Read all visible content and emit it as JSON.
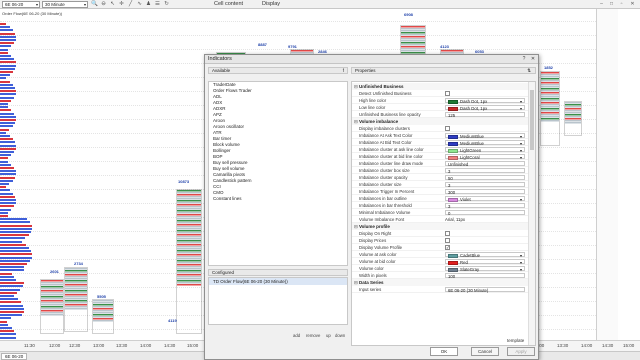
{
  "toolbar": {
    "instrument": "6E 06-20",
    "interval": "30 Minute",
    "cell_content_label": "Cell content",
    "display_label": "Display"
  },
  "chart": {
    "title": "Order Flow(6E 06-20 (30 Minute))",
    "volume_labels": [
      "8887",
      "9791",
      "2846",
      "6908",
      "4123",
      "6053",
      "1852",
      "10873",
      "2601",
      "2734",
      "5505",
      "4119"
    ],
    "time_labels": [
      "11:30",
      "12:00",
      "12:30",
      "13:00",
      "13:30",
      "14:00",
      "14:30",
      "15:00",
      "13:00",
      "13:30",
      "14:00",
      "14:30",
      "15:00"
    ],
    "tab_label": "6E 06-20"
  },
  "dialog": {
    "title": "Indicators",
    "available_label": "Available",
    "configured_label": "Configured",
    "properties_label": "Properties",
    "available_items": [
      "TraderDate",
      "Order Flows Trader",
      "ADL",
      "ADX",
      "ADXR",
      "APZ",
      "Aroon",
      "Aroon oscillator",
      "ATR",
      "Bar timer",
      "Block volume",
      "Bollinger",
      "BOP",
      "Buy sell pressure",
      "Buy sell volume",
      "Camarilla pivots",
      "Candlestick pattern",
      "CCI",
      "CMO",
      "Constant lines"
    ],
    "configured_items": [
      "TD Order Flow(6E 06-20 (30 Minute))"
    ],
    "links": {
      "add": "add",
      "remove": "remove",
      "up": "up",
      "down": "down"
    },
    "sections": [
      {
        "name": "Unfinished Business",
        "rows": [
          {
            "label": "Detect Unfinished Business",
            "type": "check",
            "checked": false
          },
          {
            "label": "High line color",
            "type": "color",
            "value": "Dash Dot, 1px",
            "swatch": "#1e7a34"
          },
          {
            "label": "Low line color",
            "type": "color",
            "value": "Dash Dot, 1px",
            "swatch": "#c62828"
          },
          {
            "label": "Unfinished Business line opacity",
            "type": "text",
            "value": "125"
          }
        ]
      },
      {
        "name": "Volume imbalance",
        "rows": [
          {
            "label": "Display imbalance clusters",
            "type": "check",
            "checked": false
          },
          {
            "label": "Imbalance At Ask Text Color",
            "type": "color",
            "value": "MediumBlue",
            "swatch": "#2e3cc2"
          },
          {
            "label": "Imbalance At Bid Text Color",
            "type": "color",
            "value": "MediumBlue",
            "swatch": "#2e3cc2"
          },
          {
            "label": "Imbalance cluster at ask line color",
            "type": "color",
            "value": "LightGreen",
            "swatch": "#8fe68f"
          },
          {
            "label": "Imbalance cluster at bid line color",
            "type": "color",
            "value": "LightCoral",
            "swatch": "#ef8080"
          },
          {
            "label": "Imbalance cluster line draw mode",
            "type": "text",
            "value": "Unfinished"
          },
          {
            "label": "Imbalance cluster box size",
            "type": "text",
            "value": "3"
          },
          {
            "label": "Imbalance cluster opacity",
            "type": "text",
            "value": "50"
          },
          {
            "label": "Imbalance cluster size",
            "type": "text",
            "value": "3"
          },
          {
            "label": "Imbalance Trigger In Percent",
            "type": "text",
            "value": "300"
          },
          {
            "label": "Imbalances in bar outline",
            "type": "color",
            "value": "Violet",
            "swatch": "#d98be0"
          },
          {
            "label": "Imbalances in bar threshold",
            "type": "text",
            "value": "3"
          },
          {
            "label": "Minimal Imbalance Volume",
            "type": "text",
            "value": "0"
          },
          {
            "label": "Volume Imbalance Font",
            "type": "plain",
            "value": "Arial, 11px"
          }
        ]
      },
      {
        "name": "Volume profile",
        "rows": [
          {
            "label": "Display On Right",
            "type": "check",
            "checked": false
          },
          {
            "label": "Display Prices",
            "type": "check",
            "checked": false
          },
          {
            "label": "Display Volume Profile",
            "type": "check",
            "checked": true
          },
          {
            "label": "Volume at ask color",
            "type": "color",
            "value": "CadetBlue",
            "swatch": "#5f9ea0"
          },
          {
            "label": "Volume at bid color",
            "type": "color",
            "value": "Red",
            "swatch": "#e02020"
          },
          {
            "label": "Volume color",
            "type": "color",
            "value": "SlateGray",
            "swatch": "#708090"
          },
          {
            "label": "Width in pixels",
            "type": "text",
            "value": "100"
          }
        ]
      },
      {
        "name": "Data Series",
        "rows": [
          {
            "label": "Input series",
            "type": "text",
            "value": "6E 06-20 (30 Minute)"
          }
        ]
      }
    ],
    "template_label": "template",
    "buttons": {
      "ok": "OK",
      "cancel": "Cancel",
      "apply": "Apply"
    }
  },
  "colors": {
    "bid": "#e04848",
    "ask": "#3a8f4a",
    "neutral": "#b9c4cc",
    "profile_blue": "#3f5fd9",
    "profile_red": "#d9363e"
  }
}
